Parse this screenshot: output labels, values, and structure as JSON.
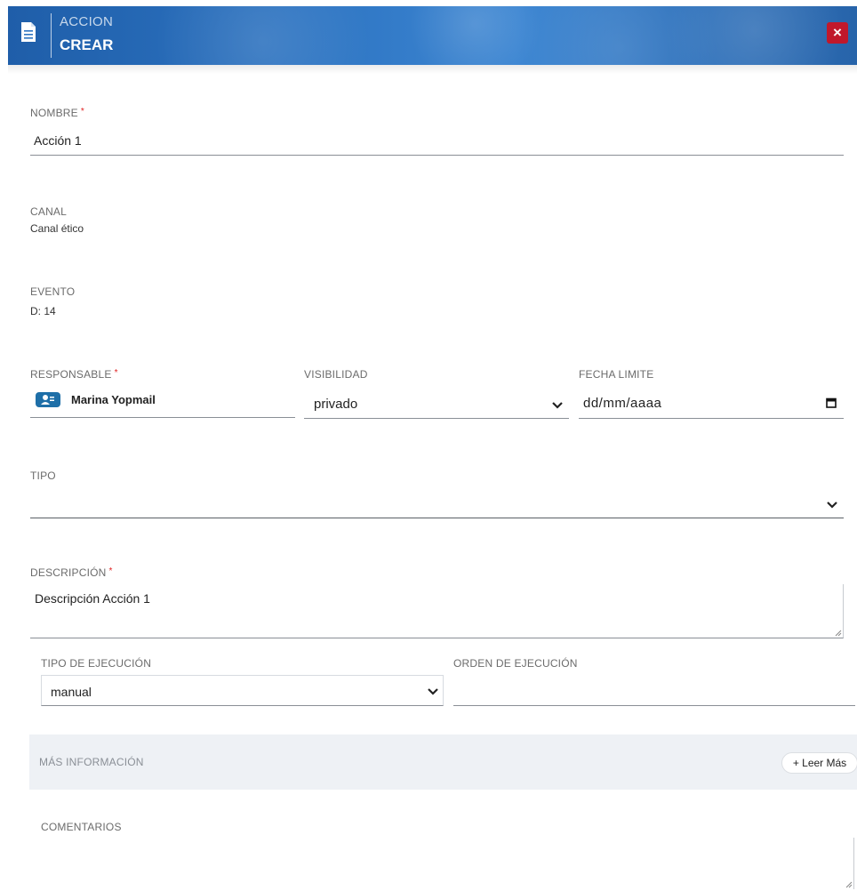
{
  "header": {
    "entity": "ACCION",
    "mode": "CREAR",
    "doc_icon": "document-icon",
    "close_icon": "close-icon",
    "close_label": "×"
  },
  "form": {
    "nombre": {
      "label": "NOMBRE",
      "required_mark": "*",
      "value": "Acción 1"
    },
    "canal": {
      "label": "CANAL",
      "value": "Canal ético"
    },
    "evento": {
      "label": "EVENTO",
      "value": "D: 14"
    },
    "responsable": {
      "label": "RESPONSABLE",
      "required_mark": "*",
      "value": "Marina Yopmail",
      "icon": "user-card-icon"
    },
    "visibilidad": {
      "label": "VISIBILIDAD",
      "value": "privado"
    },
    "fecha_limite": {
      "label": "FECHA LIMITE",
      "placeholder": "dd/mm/aaaa",
      "icon": "calendar-icon"
    },
    "tipo": {
      "label": "TIPO",
      "value": ""
    },
    "descripcion": {
      "label": "DESCRIPCIÓN",
      "required_mark": "*",
      "value": "Descripción Acción 1"
    },
    "tipo_ejecucion": {
      "label": "TIPO DE EJECUCIÓN",
      "value": "manual"
    },
    "orden_ejecucion": {
      "label": "ORDEN DE EJECUCIÓN",
      "value": ""
    },
    "mas_informacion": {
      "label": "MÁS INFORMACIÓN",
      "button": "+ Leer Más"
    },
    "comentarios": {
      "label": "COMENTARIOS",
      "value": ""
    }
  },
  "colors": {
    "header_blue": "#2d74c2",
    "close_red": "#c0182b",
    "required_red": "#e02020",
    "avatar_blue": "#1e6fa8",
    "panel_grey": "#eef1f5"
  }
}
